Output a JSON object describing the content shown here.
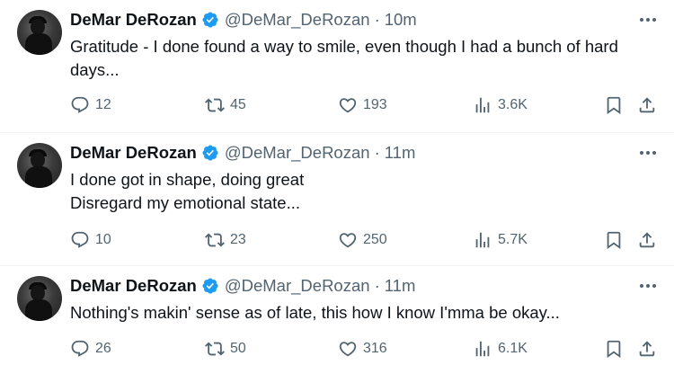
{
  "tweets": [
    {
      "name": "DeMar DeRozan",
      "handle": "@DeMar_DeRozan",
      "separator": "·",
      "time": "10m",
      "lines": [
        "Gratitude - I done found a way to smile, even though I had a bunch of hard days..."
      ],
      "replies": "12",
      "retweets": "45",
      "likes": "193",
      "views": "3.6K"
    },
    {
      "name": "DeMar DeRozan",
      "handle": "@DeMar_DeRozan",
      "separator": "·",
      "time": "11m",
      "lines": [
        "I done got in shape, doing great",
        "Disregard my emotional state..."
      ],
      "replies": "10",
      "retweets": "23",
      "likes": "250",
      "views": "5.7K"
    },
    {
      "name": "DeMar DeRozan",
      "handle": "@DeMar_DeRozan",
      "separator": "·",
      "time": "11m",
      "lines": [
        "Nothing's makin' sense as of late, this how I know I'mma be okay..."
      ],
      "replies": "26",
      "retweets": "50",
      "likes": "316",
      "views": "6.1K"
    }
  ],
  "colors": {
    "verified": "#1d9bf0",
    "secondary_text": "#536471",
    "primary_text": "#0f1419",
    "divider": "#eff3f4"
  },
  "icons": [
    "avatar",
    "verified-badge-icon",
    "more-icon",
    "reply-icon",
    "retweet-icon",
    "like-icon",
    "views-icon",
    "bookmark-icon",
    "share-icon"
  ]
}
